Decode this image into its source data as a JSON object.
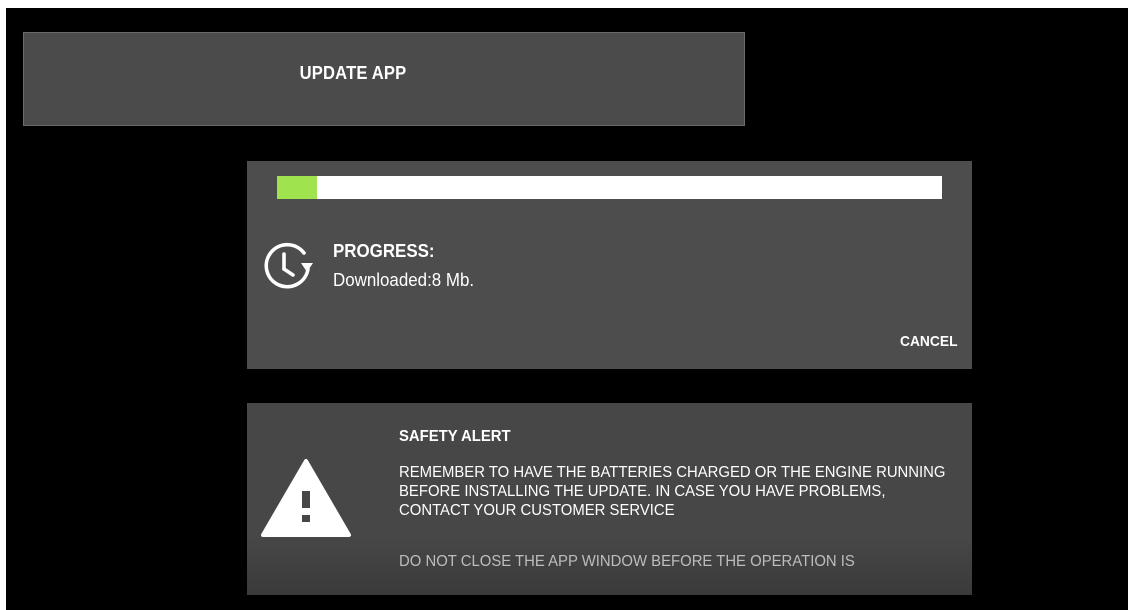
{
  "header": {
    "title": "UPDATE APP"
  },
  "progress": {
    "fraction": 0.06,
    "fill_color": "#9fe34e",
    "icon": "clock-refresh-icon",
    "label": "PROGRESS:",
    "detail": "Downloaded:8 Mb.",
    "cancel_label": "CANCEL"
  },
  "alert": {
    "icon": "warning-icon",
    "title": "SAFETY ALERT",
    "body": "REMEMBER TO HAVE THE BATTERIES CHARGED OR THE ENGINE RUNNING BEFORE INSTALLING THE UPDATE. IN CASE YOU HAVE PROBLEMS, CONTACT YOUR CUSTOMER SERVICE",
    "footer": "DO NOT CLOSE THE APP WINDOW BEFORE THE OPERATION IS"
  }
}
